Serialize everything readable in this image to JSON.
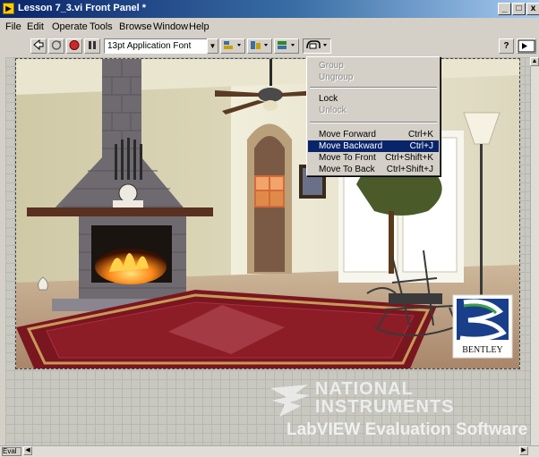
{
  "window": {
    "title": "Lesson 7_3.vi Front Panel *",
    "controls": {
      "minimize": "_",
      "maximize": "□",
      "close": "x"
    }
  },
  "menubar": {
    "items": [
      "File",
      "Edit",
      "Operate",
      "Tools",
      "Browse",
      "Window",
      "Help"
    ]
  },
  "toolbar": {
    "font": "13pt Application Font",
    "help_icon": "?",
    "run_icon": "run-arrow-icon",
    "run_continuous_icon": "run-continuous-icon",
    "abort_icon": "abort-icon",
    "pause_icon": "pause-icon"
  },
  "context_menu": {
    "items": [
      {
        "label": "Group",
        "shortcut": "",
        "enabled": false
      },
      {
        "label": "Ungroup",
        "shortcut": "",
        "enabled": false
      },
      {
        "label": "Lock",
        "shortcut": "",
        "enabled": true
      },
      {
        "label": "Unlock",
        "shortcut": "",
        "enabled": false
      },
      {
        "label": "Move Forward",
        "shortcut": "Ctrl+K",
        "enabled": true
      },
      {
        "label": "Move Backward",
        "shortcut": "Ctrl+J",
        "enabled": true,
        "selected": true
      },
      {
        "label": "Move To Front",
        "shortcut": "Ctrl+Shift+K",
        "enabled": true
      },
      {
        "label": "Move To Back",
        "shortcut": "Ctrl+Shift+J",
        "enabled": true
      }
    ]
  },
  "scene": {
    "logo_text": "BENTLEY"
  },
  "watermark": {
    "line1": "NATIONAL",
    "line2": "INSTRUMENTS",
    "line3": "LabVIEW Evaluation Software"
  },
  "statusbar": {
    "eval_label": "Eval"
  },
  "colors": {
    "title_gradient_start": "#0a246a",
    "title_gradient_end": "#a6caf0",
    "selected_bg": "#0a246a",
    "chrome": "#d4d0c8"
  }
}
